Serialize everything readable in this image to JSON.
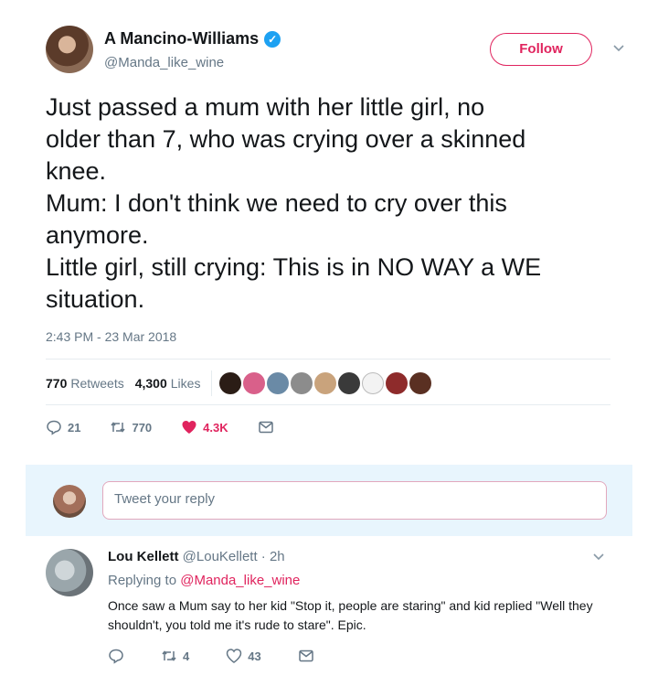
{
  "tweet": {
    "display_name": "A Mancino-Williams",
    "handle": "@Manda_like_wine",
    "follow_label": "Follow",
    "text": "Just passed a mum with her little girl, no\nolder than 7, who was crying over a skinned\nknee.\nMum: I don't think we need to cry over this\nanymore.\nLittle girl, still crying: This is in NO WAY a WE\nsituation.",
    "timestamp": "2:43 PM - 23 Mar 2018",
    "retweets_count": "770",
    "retweets_label": "Retweets",
    "likes_count": "4,300",
    "likes_label": "Likes",
    "actions": {
      "replies": "21",
      "retweets": "770",
      "likes": "4.3K"
    }
  },
  "reply_box": {
    "placeholder": "Tweet your reply"
  },
  "reply": {
    "display_name": "Lou Kellett",
    "handle_time": "@LouKellett · 2h",
    "replying_prefix": "Replying to ",
    "replying_mention": "@Manda_like_wine",
    "text": "Once saw a Mum say to her kid \"Stop it, people are staring\" and kid replied \"Well they shouldn't, you told me it's rude to stare\".  Epic.",
    "actions": {
      "retweets": "4",
      "likes": "43"
    }
  },
  "colors": {
    "accent": "#e0245e",
    "muted": "#657786",
    "verified": "#1da1f2",
    "reply_bg": "#e8f5fd"
  }
}
